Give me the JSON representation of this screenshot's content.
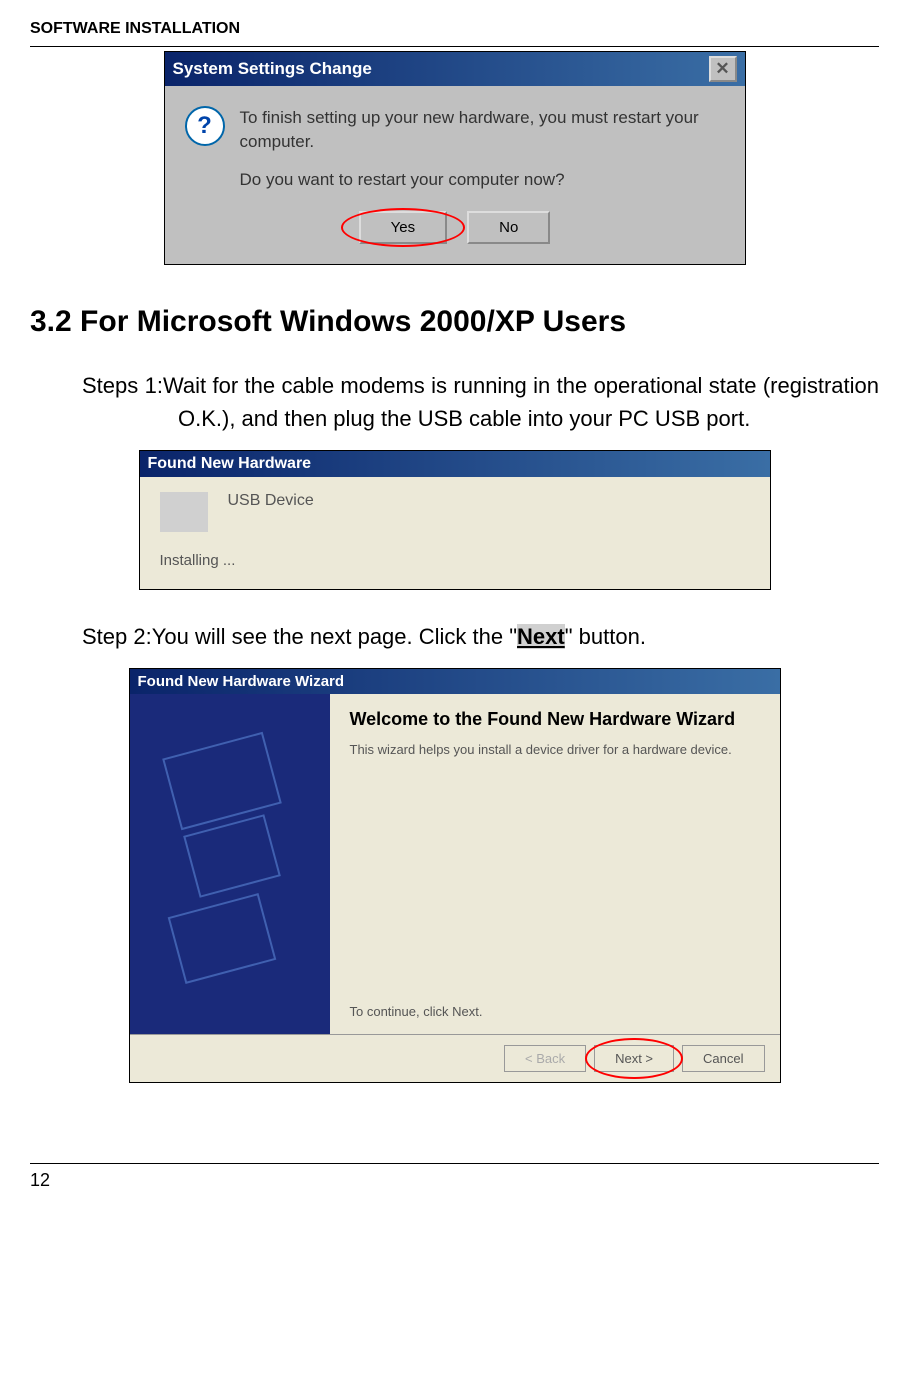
{
  "header": {
    "title": "SOFTWARE INSTALLATION"
  },
  "dialog1": {
    "title": "System Settings Change",
    "line1": "To finish setting up your new hardware, you must restart your computer.",
    "line2": "Do you want to restart your computer now?",
    "yes_label": "Yes",
    "no_label": "No"
  },
  "section": {
    "heading": "3.2 For Microsoft Windows 2000/XP Users"
  },
  "step1": {
    "text": "Steps 1:Wait for the cable modems is running in the operational state (registration O.K.), and then plug the USB cable into your PC USB port."
  },
  "found_hw": {
    "title": "Found New Hardware",
    "device": "USB Device",
    "status": "Installing ..."
  },
  "step2": {
    "prefix": "Step 2:You will see the next page. Click the \"",
    "bold": "Next",
    "suffix": "\" button."
  },
  "wizard": {
    "title": "Found New Hardware Wizard",
    "heading": "Welcome to the Found New Hardware Wizard",
    "desc": "This wizard helps you install a device driver for a hardware device.",
    "continue": "To continue, click Next.",
    "back_label": "< Back",
    "next_label": "Next >",
    "cancel_label": "Cancel"
  },
  "page_number": "12"
}
